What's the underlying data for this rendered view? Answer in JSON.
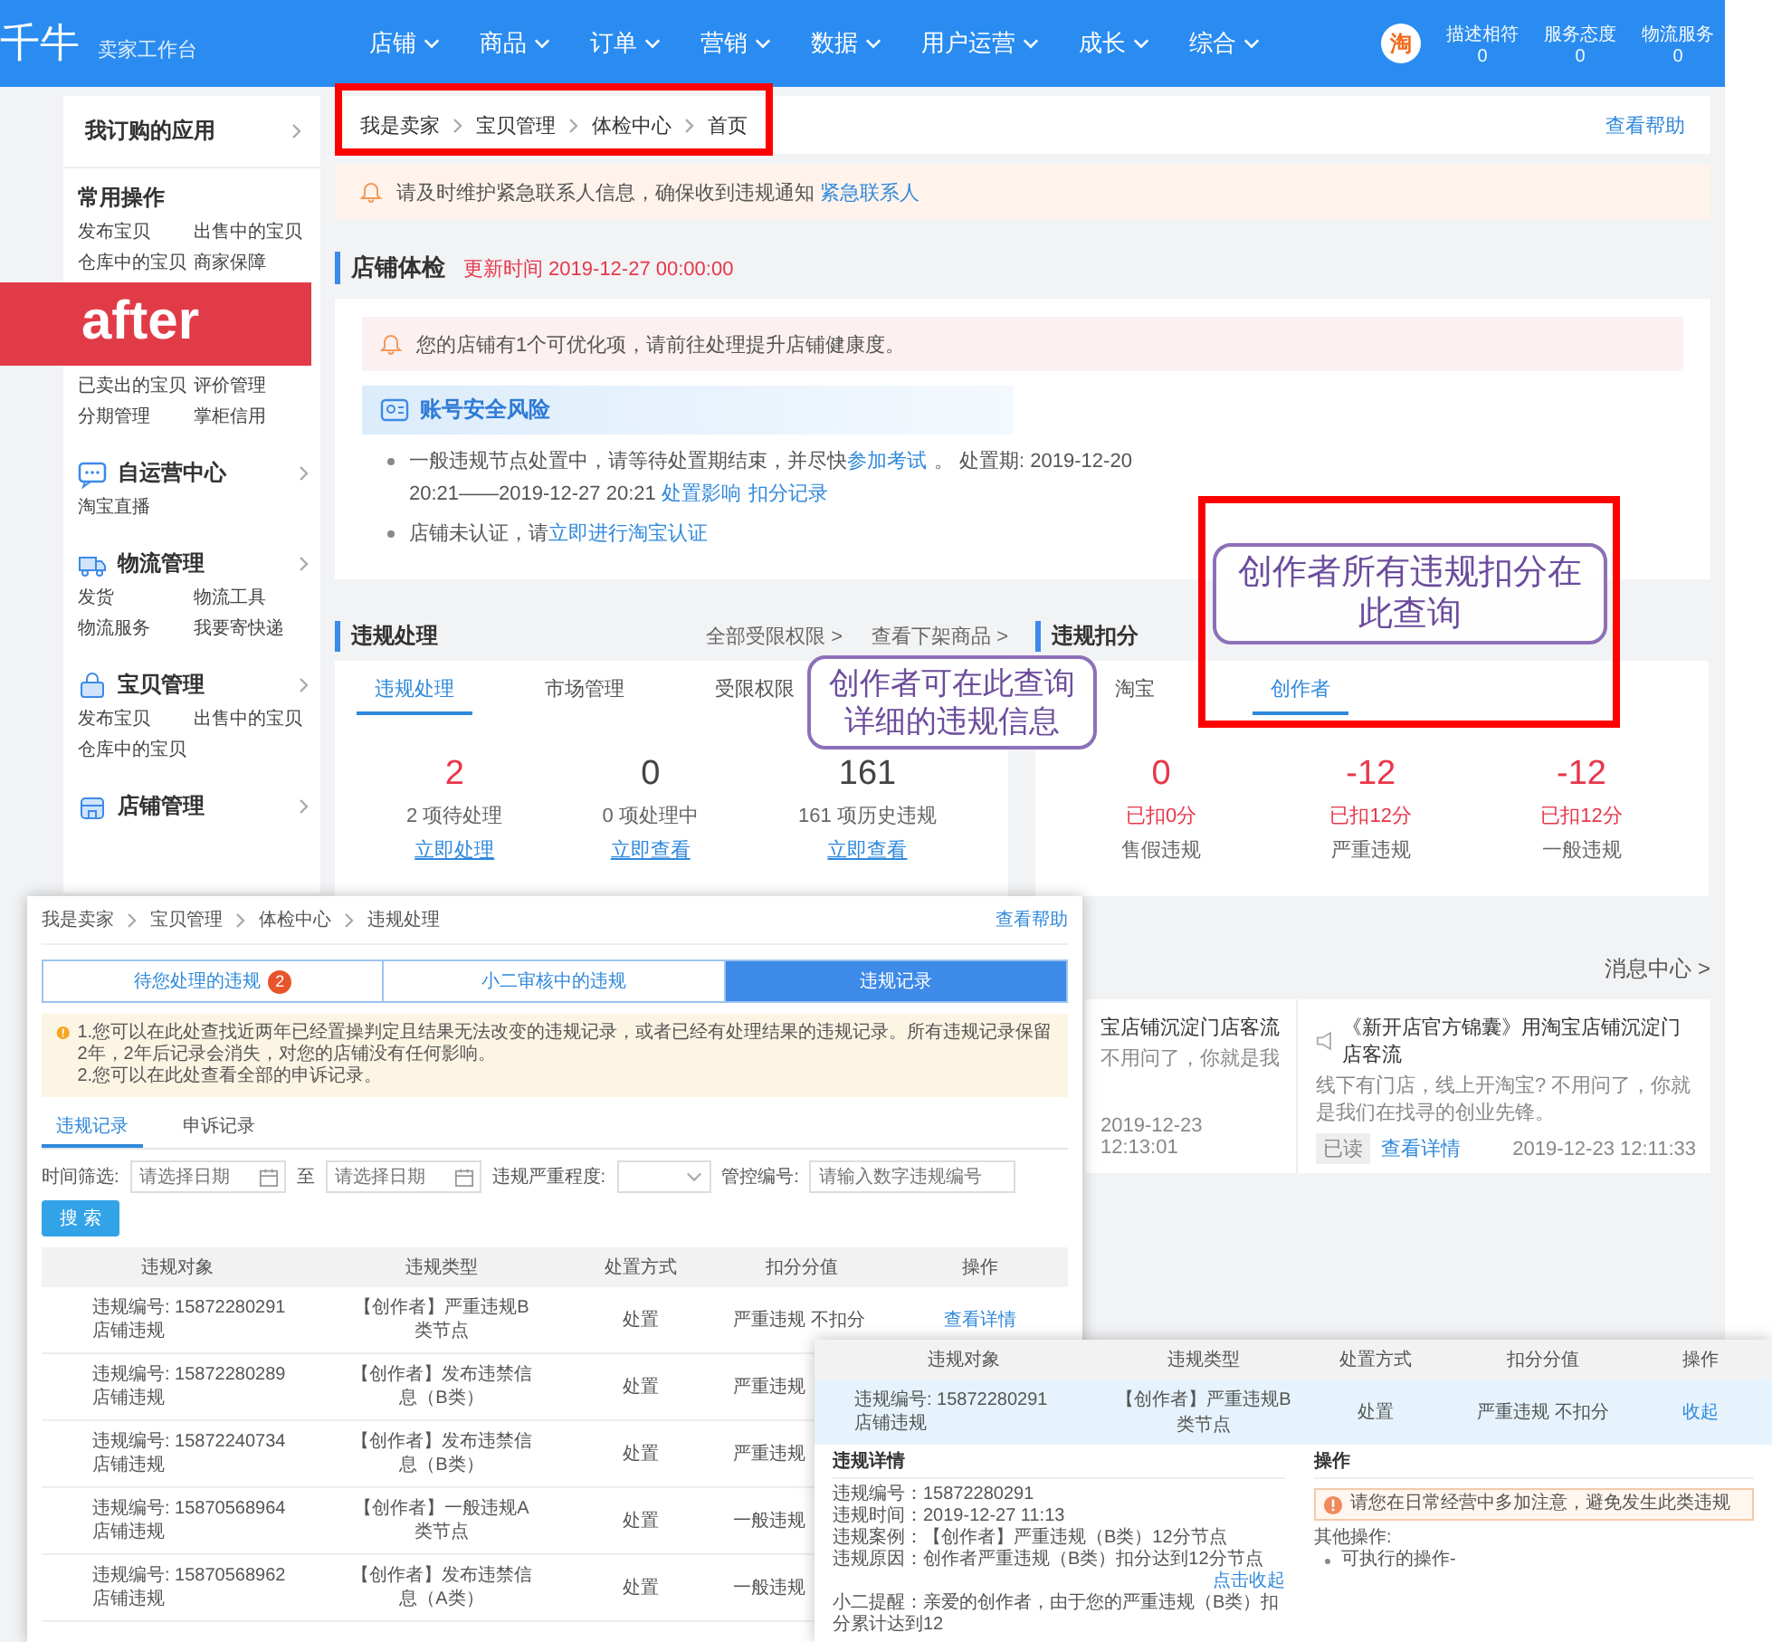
{
  "topbar": {
    "logo": "千牛",
    "subtitle": "卖家工作台",
    "nav": [
      {
        "label": "店铺"
      },
      {
        "label": "商品"
      },
      {
        "label": "订单"
      },
      {
        "label": "营销"
      },
      {
        "label": "数据"
      },
      {
        "label": "用户运营"
      },
      {
        "label": "成长"
      },
      {
        "label": "综合"
      }
    ],
    "avatar": "淘",
    "ratings": [
      {
        "label": "描述相符",
        "value": "0"
      },
      {
        "label": "服务态度",
        "value": "0"
      },
      {
        "label": "物流服务",
        "value": "0"
      }
    ]
  },
  "sidebar": {
    "sections": [
      {
        "kind": "link",
        "title": "我订购的应用"
      },
      {
        "kind": "plain",
        "title": "常用操作",
        "items": [
          "发布宝贝",
          "出售中的宝贝",
          "仓库中的宝贝",
          "商家保障",
          "已卖出的宝贝",
          "评价管理",
          "分期管理",
          "掌柜信用"
        ]
      },
      {
        "kind": "module",
        "title": "自运营中心",
        "items": [
          "淘宝直播"
        ]
      },
      {
        "kind": "module",
        "title": "物流管理",
        "items": [
          "发货",
          "物流工具",
          "物流服务",
          "我要寄快递"
        ]
      },
      {
        "kind": "module",
        "title": "宝贝管理",
        "items": [
          "发布宝贝",
          "出售中的宝贝",
          "仓库中的宝贝"
        ]
      },
      {
        "kind": "module",
        "title": "店铺管理"
      }
    ]
  },
  "stamp": "after",
  "main": {
    "breadcrumb": [
      "我是卖家",
      "宝贝管理",
      "体检中心",
      "首页"
    ],
    "help": "查看帮助",
    "notice": {
      "text": "请及时维护紧急联系人信息，确保收到违规通知",
      "link": "紧急联系人"
    },
    "health": {
      "title": "店铺体检",
      "updated": "更新时间 2019-12-27 00:00:00",
      "alert": "您的店铺有1个可优化项，请前往处理提升店铺健康度。",
      "risk_title": "账号安全风险",
      "bullets": [
        [
          {
            "kind": "text",
            "text": "一般违规节点处置中，请等待处置期结束，并尽快"
          },
          {
            "kind": "link",
            "text": "参加考试"
          },
          {
            "kind": "text",
            "text": "。 处置期: 2019-12-20 20:21——2019-12-27 20:21 "
          },
          {
            "kind": "link",
            "text": "处置影响"
          },
          {
            "kind": "link",
            "text": "扣分记录"
          }
        ],
        [
          {
            "kind": "text",
            "text": "店铺未认证，请"
          },
          {
            "kind": "link",
            "text": "立即进行淘宝认证"
          }
        ]
      ]
    },
    "violations": {
      "title": "违规处理",
      "links": [
        "全部受限权限 >",
        "查看下架商品 >"
      ],
      "tabs": [
        {
          "label": "违规处理",
          "selected": true
        },
        {
          "label": "市场管理",
          "selected": false
        },
        {
          "label": "受限权限",
          "selected": false
        }
      ],
      "stats": [
        {
          "value": "2",
          "label": "2 项待处理",
          "link": "立即处理",
          "alert": true
        },
        {
          "value": "0",
          "label": "0 项处理中",
          "link": "立即查看",
          "alert": false
        },
        {
          "value": "161",
          "label": "161 项历史违规",
          "link": "立即查看",
          "alert": false
        }
      ]
    },
    "points": {
      "title": "违规扣分",
      "tabs": [
        {
          "label": "淘宝",
          "selected": false
        },
        {
          "label": "创作者",
          "selected": true
        }
      ],
      "stats": [
        {
          "value": "0",
          "deducted": "已扣0分",
          "label": "售假违规"
        },
        {
          "value": "-12",
          "deducted": "已扣12分",
          "label": "严重违规"
        },
        {
          "value": "-12",
          "deducted": "已扣12分",
          "label": "一般违规"
        }
      ]
    },
    "messages": {
      "link": "消息中心 >",
      "items": [
        {
          "title": "宝店铺沉淀门店客流",
          "body": "不用问了，你就是我",
          "time": "2019-12-23 12:13:01"
        },
        {
          "title": "《新开店官方锦囊》用淘宝店铺沉淀门店客流",
          "body": "线下有门店，线上开淘宝? 不用问了，你就是我们在找寻的创业先锋。",
          "read": "已读",
          "link": "查看详情",
          "time": "2019-12-23 12:11:33"
        }
      ]
    }
  },
  "callouts": [
    {
      "text": "创作者可在此查询详细的违规信息"
    },
    {
      "text": "创作者所有违规扣分在此查询"
    }
  ],
  "record_window": {
    "breadcrumb": [
      "我是卖家",
      "宝贝管理",
      "体检中心",
      "违规处理"
    ],
    "help": "查看帮助",
    "tabs": [
      {
        "label": "待您处理的违规",
        "badge": "2",
        "selected": false
      },
      {
        "label": "小二审核中的违规",
        "selected": false
      },
      {
        "label": "违规记录",
        "selected": true
      }
    ],
    "notice": [
      "1.您可以在此处查找近两年已经置操判定且结果无法改变的违规记录，或者已经有处理结果的违规记录。所有违规记录保留2年，2年后记录会消失，对您的店铺没有任何影响。",
      "2.您可以在此处查看全部的申诉记录。"
    ],
    "subtabs": [
      {
        "label": "违规记录",
        "selected": true
      },
      {
        "label": "申诉记录",
        "selected": false
      }
    ],
    "filters": {
      "time_label": "时间筛选:",
      "start_placeholder": "请选择日期",
      "to": "至",
      "end_placeholder": "请选择日期",
      "severity_label": "违规严重程度:",
      "id_label": "管控编号:",
      "id_placeholder": "请输入数字违规编号"
    },
    "search": "搜 索",
    "columns": [
      "违规对象",
      "违规类型",
      "处置方式",
      "扣分分值",
      "操作"
    ],
    "rows": [
      {
        "id": "违规编号: 15872280291",
        "scope": "店铺违规",
        "type": "【创作者】严重违规B类节点",
        "action": "处置",
        "points": "严重违规 不扣分",
        "op": "查看详情"
      },
      {
        "id": "违规编号: 15872280289",
        "scope": "店铺违规",
        "type": "【创作者】发布违禁信息（B类）",
        "action": "处置",
        "points": "严重违规"
      },
      {
        "id": "违规编号: 15872240734",
        "scope": "店铺违规",
        "type": "【创作者】发布违禁信息（B类）",
        "action": "处置",
        "points": "严重违规"
      },
      {
        "id": "违规编号: 15870568964",
        "scope": "店铺违规",
        "type": "【创作者】一般违规A类节点",
        "action": "处置",
        "points": "一般违规"
      },
      {
        "id": "违规编号: 15870568962",
        "scope": "店铺违规",
        "type": "【创作者】发布违禁信息（A类）",
        "action": "处置",
        "points": "一般违规"
      }
    ]
  },
  "detail_window": {
    "columns": [
      "违规对象",
      "违规类型",
      "处置方式",
      "扣分分值",
      "操作"
    ],
    "row": {
      "id": "违规编号: 15872280291",
      "scope": "店铺违规",
      "type": "【创作者】严重违规B类节点",
      "action": "处置",
      "points": "严重违规 不扣分",
      "op": "收起"
    },
    "detail_title": "违规详情",
    "lines": [
      "违规编号：15872280291",
      "违规时间：2019-12-27 11:13",
      "违规案例：【创作者】严重违规（B类）12分节点",
      "违规原因：创作者严重违规（B类）扣分达到12分节点"
    ],
    "collapse": "点击收起",
    "reminder": "小二提醒：亲爱的创作者，由于您的严重违规（B类）扣分累计达到12",
    "ops_title": "操作",
    "ops_notice": "请您在日常经营中多加注意，避免发生此类违规",
    "other": "其他操作:",
    "ops_items": [
      "可执行的操作-"
    ]
  }
}
